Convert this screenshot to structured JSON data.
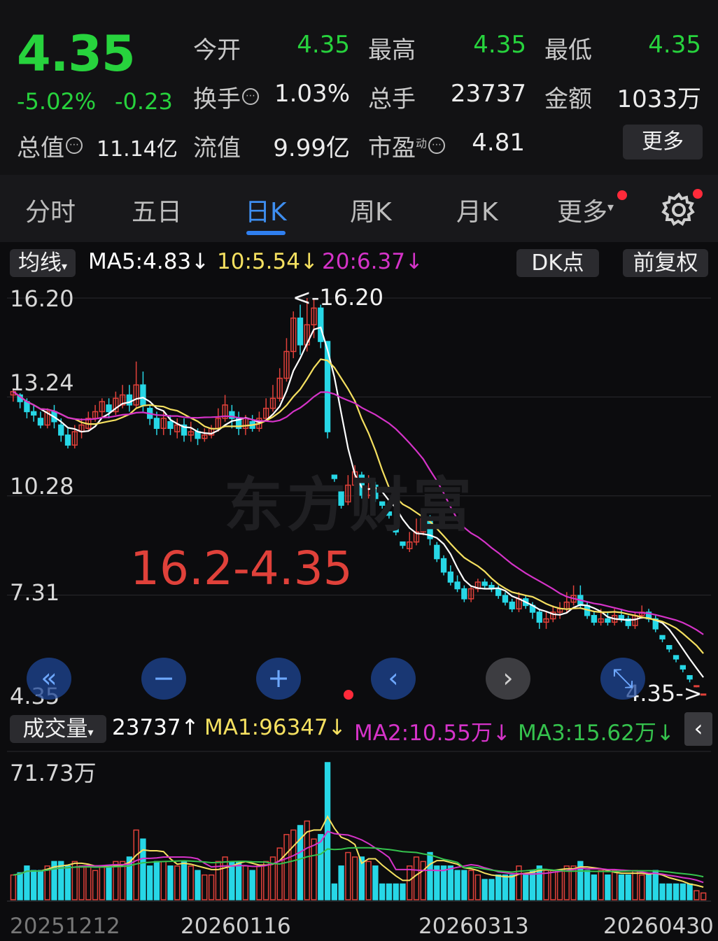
{
  "quote": {
    "price": "4.35",
    "change_pct": "-5.02%",
    "change": "-0.23",
    "open_label": "今开",
    "open": "4.35",
    "high_label": "最高",
    "high": "4.35",
    "low_label": "最低",
    "low": "4.35",
    "turnover_label": "换手",
    "turnover": "1.03%",
    "volume_label": "总手",
    "volume": "23737",
    "amount_label": "金额",
    "amount": "1033万",
    "mcap_label": "总值",
    "mcap": "11.14亿",
    "float_label": "流值",
    "float": "9.99亿",
    "pe_label": "市盈",
    "pe_sup": "动",
    "pe": "4.81",
    "more_label": "更多",
    "info_glyph": "⋯"
  },
  "tabs": [
    {
      "label": "分时"
    },
    {
      "label": "五日"
    },
    {
      "label": "日K"
    },
    {
      "label": "周K"
    },
    {
      "label": "月K"
    },
    {
      "label": "更多"
    }
  ],
  "tab_more_arrow": "▾",
  "active_tab": "日K",
  "ma": {
    "selector": "均线",
    "ma5": "MA5:4.83",
    "ma10": "10:5.54",
    "ma20": "20:6.37",
    "down": "↓",
    "dk": "DK点",
    "adjust": "前复权"
  },
  "price_axis": [
    "16.20",
    "13.24",
    "10.28",
    "7.31",
    "4.35"
  ],
  "annotation_high": "<-16.20",
  "annotation_last": "4.35->",
  "big_label": "16.2-4.35",
  "watermark": "东方财富",
  "volume_bar": {
    "selector": "成交量",
    "value": "23737",
    "up": "↑",
    "ma1": "MA1:96347",
    "ma2": "MA2:10.55万",
    "ma3": "MA3:15.62万",
    "down": "↓",
    "collapse": "‹"
  },
  "volume_axis_max": "71.73万",
  "dates": [
    "20251212",
    "20260116",
    "20260313",
    "20260430"
  ],
  "controls": [
    "«",
    "−",
    "+",
    "‹",
    "›",
    "⤡"
  ],
  "colors": {
    "up": "#e0413a",
    "down": "#27d7e6",
    "ma5": "#ffffff",
    "ma10": "#f5e060",
    "ma20": "#d533c8",
    "green": "#27d33d",
    "accent": "#2f7ff0"
  },
  "chart_data": {
    "type": "candlestick",
    "ylim": [
      4.35,
      16.2
    ],
    "candles": [
      [
        13.3,
        13.4,
        13.5,
        13.1
      ],
      [
        13.3,
        13.1,
        13.35,
        12.9
      ],
      [
        13.1,
        12.8,
        13.2,
        12.6
      ],
      [
        12.8,
        12.7,
        13.0,
        12.5
      ],
      [
        12.6,
        12.4,
        12.8,
        12.3
      ],
      [
        12.4,
        12.8,
        12.9,
        12.3
      ],
      [
        12.8,
        12.5,
        13.0,
        12.3
      ],
      [
        12.4,
        12.1,
        12.6,
        11.9
      ],
      [
        12.1,
        11.8,
        12.3,
        11.7
      ],
      [
        11.8,
        12.2,
        12.4,
        11.7
      ],
      [
        12.2,
        12.4,
        12.6,
        12.0
      ],
      [
        12.3,
        12.6,
        12.8,
        12.2
      ],
      [
        12.6,
        12.8,
        13.0,
        12.5
      ],
      [
        12.8,
        13.1,
        13.2,
        12.6
      ],
      [
        13.0,
        12.8,
        13.2,
        12.6
      ],
      [
        12.8,
        13.2,
        13.4,
        12.7
      ],
      [
        13.0,
        13.3,
        13.6,
        12.9
      ],
      [
        13.3,
        13.0,
        13.6,
        12.8
      ],
      [
        13.0,
        13.6,
        14.3,
        12.9
      ],
      [
        13.6,
        13.0,
        14.0,
        12.8
      ],
      [
        12.9,
        12.6,
        13.0,
        12.4
      ],
      [
        12.6,
        12.3,
        12.8,
        12.1
      ],
      [
        12.3,
        12.6,
        12.8,
        12.1
      ],
      [
        12.5,
        12.3,
        12.7,
        12.1
      ],
      [
        12.2,
        12.4,
        12.6,
        12.0
      ],
      [
        12.4,
        12.1,
        12.6,
        11.9
      ],
      [
        12.1,
        12.2,
        12.5,
        11.9
      ],
      [
        12.2,
        12.0,
        12.3,
        11.8
      ],
      [
        12.0,
        12.1,
        12.3,
        11.9
      ],
      [
        12.1,
        12.3,
        12.4,
        12.0
      ],
      [
        12.3,
        12.6,
        12.9,
        12.2
      ],
      [
        12.6,
        13.0,
        13.3,
        12.5
      ],
      [
        12.8,
        12.6,
        13.0,
        12.3
      ],
      [
        12.6,
        12.3,
        12.8,
        12.1
      ],
      [
        12.3,
        12.6,
        12.7,
        12.1
      ],
      [
        12.5,
        12.3,
        12.7,
        12.2
      ],
      [
        12.3,
        12.6,
        12.8,
        12.2
      ],
      [
        12.6,
        12.9,
        13.2,
        12.5
      ],
      [
        12.9,
        13.2,
        13.6,
        12.8
      ],
      [
        13.2,
        13.8,
        14.1,
        13.1
      ],
      [
        13.8,
        14.6,
        15.0,
        13.7
      ],
      [
        14.6,
        15.6,
        15.8,
        14.4
      ],
      [
        15.6,
        14.8,
        16.0,
        14.5
      ],
      [
        14.8,
        15.4,
        16.2,
        14.6
      ],
      [
        15.4,
        15.9,
        16.2,
        15.0
      ],
      [
        15.9,
        14.9,
        16.0,
        14.7
      ],
      [
        14.9,
        12.2,
        14.9,
        12.0
      ],
      [
        10.9,
        10.8,
        10.9,
        10.7
      ],
      [
        10.4,
        10.0,
        10.5,
        9.9
      ],
      [
        10.1,
        10.6,
        10.9,
        10.0
      ],
      [
        10.6,
        11.0,
        11.2,
        10.4
      ],
      [
        10.9,
        10.3,
        11.0,
        10.2
      ],
      [
        10.3,
        10.5,
        10.9,
        10.2
      ],
      [
        10.6,
        10.2,
        10.7,
        10.1
      ],
      [
        10.1,
        10.0,
        10.1,
        9.9
      ],
      [
        9.8,
        9.7,
        9.8,
        9.6
      ],
      [
        9.3,
        9.2,
        9.3,
        9.1
      ],
      [
        8.9,
        8.8,
        8.9,
        8.7
      ],
      [
        8.7,
        8.9,
        9.2,
        8.6
      ],
      [
        8.9,
        9.2,
        9.6,
        8.8
      ],
      [
        9.2,
        9.6,
        9.8,
        9.1
      ],
      [
        9.6,
        9.0,
        9.7,
        8.8
      ],
      [
        8.8,
        8.4,
        8.9,
        8.3
      ],
      [
        8.4,
        8.0,
        8.5,
        7.9
      ],
      [
        8.0,
        7.7,
        8.2,
        7.6
      ],
      [
        7.7,
        7.5,
        7.9,
        7.4
      ],
      [
        7.5,
        7.2,
        7.6,
        7.1
      ],
      [
        7.2,
        7.5,
        7.6,
        7.1
      ],
      [
        7.5,
        7.7,
        7.8,
        7.4
      ],
      [
        7.7,
        7.6,
        7.8,
        7.5
      ],
      [
        7.6,
        7.5,
        7.7,
        7.4
      ],
      [
        7.5,
        7.3,
        7.6,
        7.2
      ],
      [
        7.3,
        7.1,
        7.4,
        7.0
      ],
      [
        7.1,
        6.9,
        7.2,
        6.8
      ],
      [
        6.9,
        7.2,
        7.4,
        6.8
      ],
      [
        7.2,
        7.0,
        7.3,
        6.9
      ],
      [
        7.0,
        6.8,
        7.1,
        6.6
      ],
      [
        6.8,
        6.5,
        6.9,
        6.3
      ],
      [
        6.5,
        6.6,
        6.8,
        6.3
      ],
      [
        6.6,
        6.8,
        7.0,
        6.5
      ],
      [
        6.8,
        6.9,
        7.1,
        6.6
      ],
      [
        6.9,
        7.1,
        7.4,
        6.8
      ],
      [
        7.1,
        7.3,
        7.6,
        7.0
      ],
      [
        7.3,
        7.0,
        7.6,
        6.9
      ],
      [
        7.0,
        6.7,
        7.1,
        6.6
      ],
      [
        6.7,
        6.5,
        6.8,
        6.4
      ],
      [
        6.5,
        6.6,
        6.9,
        6.4
      ],
      [
        6.6,
        6.5,
        6.8,
        6.4
      ],
      [
        6.5,
        6.7,
        6.9,
        6.4
      ],
      [
        6.7,
        6.6,
        6.9,
        6.5
      ],
      [
        6.6,
        6.4,
        6.7,
        6.3
      ],
      [
        6.4,
        6.7,
        6.8,
        6.3
      ],
      [
        6.7,
        6.8,
        7.0,
        6.6
      ],
      [
        6.8,
        6.6,
        6.9,
        6.5
      ],
      [
        6.6,
        6.3,
        6.7,
        6.2
      ],
      [
        6.1,
        6.0,
        6.1,
        5.9
      ],
      [
        5.8,
        5.7,
        5.8,
        5.6
      ],
      [
        5.5,
        5.4,
        5.5,
        5.3
      ],
      [
        5.2,
        5.1,
        5.2,
        5.0
      ],
      [
        4.9,
        4.8,
        4.9,
        4.7
      ],
      [
        4.6,
        4.6,
        4.6,
        4.55
      ],
      [
        4.35,
        4.35,
        4.35,
        4.35
      ]
    ],
    "volumes": [],
    "volume_ylim": [
      0,
      717300
    ]
  }
}
